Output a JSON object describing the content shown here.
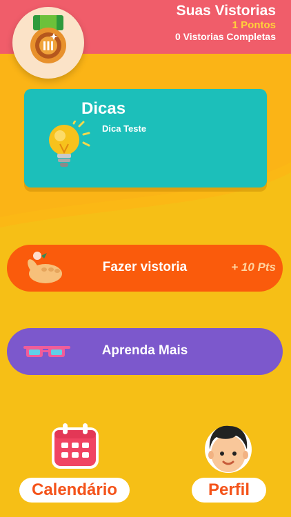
{
  "header": {
    "title": "Suas Vistorias",
    "points": "1 Pontos",
    "completed": "0 Vistorias Completas",
    "badge_icon": "medal-icon"
  },
  "tip_card": {
    "title": "Dicas",
    "text": "Dica Teste",
    "icon": "lightbulb-icon"
  },
  "actions": {
    "inspection_label": "Fazer vistoria",
    "inspection_points": "+ 10 Pts",
    "learn_label": "Aprenda Mais"
  },
  "bottom": {
    "calendar_label": "Calendário",
    "profile_label": "Perfil"
  },
  "colors": {
    "header": "#f05d6a",
    "background": "#f6bf16",
    "card": "#1cbfba",
    "inspection": "#fa5b0c",
    "learn": "#7c58cc",
    "bottom_text": "#f4531a"
  }
}
